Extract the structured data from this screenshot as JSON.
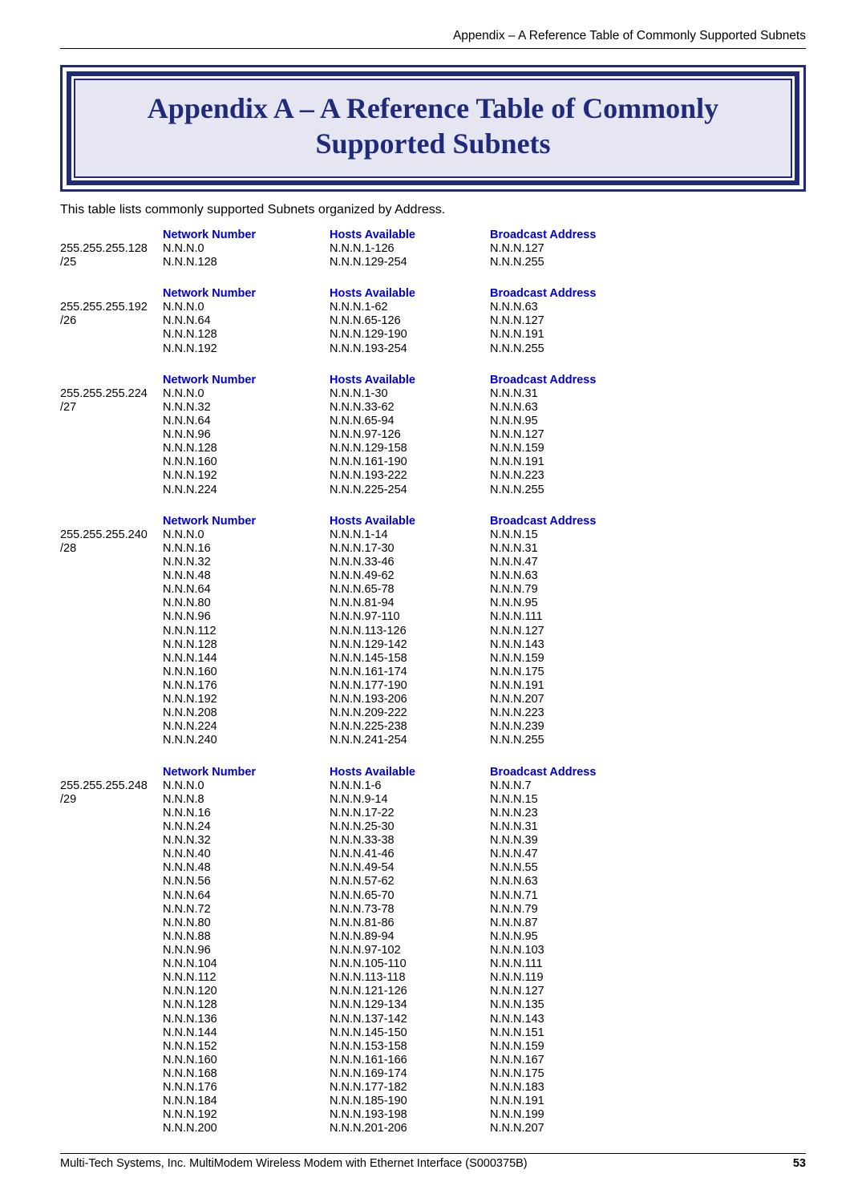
{
  "running_head": "Appendix – A Reference Table of Commonly Supported Subnets",
  "title": "Appendix A – A Reference Table of Commonly Supported Subnets",
  "intro": "This table lists commonly supported Subnets organized by Address.",
  "headers": {
    "net": "Network Number",
    "hosts": "Hosts Available",
    "bcast": "Broadcast Address"
  },
  "footer": {
    "text": "Multi-Tech Systems, Inc. MultiModem Wireless Modem with Ethernet Interface (S000375B)",
    "page": "53"
  },
  "sections": [
    {
      "mask": "255.255.255.128",
      "cidr": "/25",
      "rows": [
        {
          "net": "N.N.N.0",
          "hosts": "N.N.N.1-126",
          "bcast": "N.N.N.127"
        },
        {
          "net": "N.N.N.128",
          "hosts": "N.N.N.129-254",
          "bcast": "N.N.N.255"
        }
      ]
    },
    {
      "mask": "255.255.255.192",
      "cidr": "/26",
      "rows": [
        {
          "net": "N.N.N.0",
          "hosts": "N.N.N.1-62",
          "bcast": "N.N.N.63"
        },
        {
          "net": "N.N.N.64",
          "hosts": "N.N.N.65-126",
          "bcast": "N.N.N.127"
        },
        {
          "net": "N.N.N.128",
          "hosts": "N.N.N.129-190",
          "bcast": "N.N.N.191"
        },
        {
          "net": "N.N.N.192",
          "hosts": "N.N.N.193-254",
          "bcast": "N.N.N.255"
        }
      ]
    },
    {
      "mask": "255.255.255.224",
      "cidr": "/27",
      "rows": [
        {
          "net": "N.N.N.0",
          "hosts": "N.N.N.1-30",
          "bcast": "N.N.N.31"
        },
        {
          "net": "N.N.N.32",
          "hosts": "N.N.N.33-62",
          "bcast": "N.N.N.63"
        },
        {
          "net": "N.N.N.64",
          "hosts": "N.N.N.65-94",
          "bcast": "N.N.N.95"
        },
        {
          "net": "N.N.N.96",
          "hosts": "N.N.N.97-126",
          "bcast": "N.N.N.127"
        },
        {
          "net": "N.N.N.128",
          "hosts": "N.N.N.129-158",
          "bcast": "N.N.N.159"
        },
        {
          "net": "N.N.N.160",
          "hosts": "N.N.N.161-190",
          "bcast": "N.N.N.191"
        },
        {
          "net": "N.N.N.192",
          "hosts": "N.N.N.193-222",
          "bcast": "N.N.N.223"
        },
        {
          "net": "N.N.N.224",
          "hosts": "N.N.N.225-254",
          "bcast": "N.N.N.255"
        }
      ]
    },
    {
      "mask": "255.255.255.240",
      "cidr": "/28",
      "rows": [
        {
          "net": "N.N.N.0",
          "hosts": "N.N.N.1-14",
          "bcast": "N.N.N.15"
        },
        {
          "net": "N.N.N.16",
          "hosts": "N.N.N.17-30",
          "bcast": "N.N.N.31"
        },
        {
          "net": "N.N.N.32",
          "hosts": "N.N.N.33-46",
          "bcast": "N.N.N.47"
        },
        {
          "net": "N.N.N.48",
          "hosts": "N.N.N.49-62",
          "bcast": "N.N.N.63"
        },
        {
          "net": "N.N.N.64",
          "hosts": "N.N.N.65-78",
          "bcast": "N.N.N.79"
        },
        {
          "net": "N.N.N.80",
          "hosts": "N.N.N.81-94",
          "bcast": "N.N.N.95"
        },
        {
          "net": "N.N.N.96",
          "hosts": "N.N.N.97-110",
          "bcast": "N.N.N.111"
        },
        {
          "net": "N.N.N.112",
          "hosts": "N.N.N.113-126",
          "bcast": "N.N.N.127"
        },
        {
          "net": "N.N.N.128",
          "hosts": "N.N.N.129-142",
          "bcast": "N.N.N.143"
        },
        {
          "net": "N.N.N.144",
          "hosts": "N.N.N.145-158",
          "bcast": "N.N.N.159"
        },
        {
          "net": "N.N.N.160",
          "hosts": "N.N.N.161-174",
          "bcast": "N.N.N.175"
        },
        {
          "net": "N.N.N.176",
          "hosts": "N.N.N.177-190",
          "bcast": "N.N.N.191"
        },
        {
          "net": "N.N.N.192",
          "hosts": "N.N.N.193-206",
          "bcast": "N.N.N.207"
        },
        {
          "net": "N.N.N.208",
          "hosts": "N.N.N.209-222",
          "bcast": "N.N.N.223"
        },
        {
          "net": "N.N.N.224",
          "hosts": "N.N.N.225-238",
          "bcast": "N.N.N.239"
        },
        {
          "net": "N.N.N.240",
          "hosts": "N.N.N.241-254",
          "bcast": "N.N.N.255"
        }
      ]
    },
    {
      "mask": "255.255.255.248",
      "cidr": "/29",
      "rows": [
        {
          "net": "N.N.N.0",
          "hosts": "N.N.N.1-6",
          "bcast": "N.N.N.7"
        },
        {
          "net": "N.N.N.8",
          "hosts": "N.N.N.9-14",
          "bcast": "N.N.N.15"
        },
        {
          "net": "N.N.N.16",
          "hosts": "N.N.N.17-22",
          "bcast": "N.N.N.23"
        },
        {
          "net": "N.N.N.24",
          "hosts": "N.N.N.25-30",
          "bcast": "N.N.N.31"
        },
        {
          "net": "N.N.N.32",
          "hosts": "N.N.N.33-38",
          "bcast": "N.N.N.39"
        },
        {
          "net": "N.N.N.40",
          "hosts": "N.N.N.41-46",
          "bcast": "N.N.N.47"
        },
        {
          "net": "N.N.N.48",
          "hosts": "N.N.N.49-54",
          "bcast": "N.N.N.55"
        },
        {
          "net": "N.N.N.56",
          "hosts": "N.N.N.57-62",
          "bcast": "N.N.N.63"
        },
        {
          "net": "N.N.N.64",
          "hosts": "N.N.N.65-70",
          "bcast": "N.N.N.71"
        },
        {
          "net": "N.N.N.72",
          "hosts": "N.N.N.73-78",
          "bcast": "N.N.N.79"
        },
        {
          "net": "N.N.N.80",
          "hosts": "N.N.N.81-86",
          "bcast": "N.N.N.87"
        },
        {
          "net": "N.N.N.88",
          "hosts": "N.N.N.89-94",
          "bcast": "N.N.N.95"
        },
        {
          "net": "N.N.N.96",
          "hosts": "N.N.N.97-102",
          "bcast": "N.N.N.103"
        },
        {
          "net": "N.N.N.104",
          "hosts": "N.N.N.105-110",
          "bcast": "N.N.N.111"
        },
        {
          "net": "N.N.N.112",
          "hosts": "N.N.N.113-118",
          "bcast": "N.N.N.119"
        },
        {
          "net": "N.N.N.120",
          "hosts": "N.N.N.121-126",
          "bcast": "N.N.N.127"
        },
        {
          "net": "N.N.N.128",
          "hosts": "N.N.N.129-134",
          "bcast": "N.N.N.135"
        },
        {
          "net": "N.N.N.136",
          "hosts": "N.N.N.137-142",
          "bcast": "N.N.N.143"
        },
        {
          "net": "N.N.N.144",
          "hosts": "N.N.N.145-150",
          "bcast": "N.N.N.151"
        },
        {
          "net": "N.N.N.152",
          "hosts": "N.N.N.153-158",
          "bcast": "N.N.N.159"
        },
        {
          "net": "N.N.N.160",
          "hosts": "N.N.N.161-166",
          "bcast": "N.N.N.167"
        },
        {
          "net": "N.N.N.168",
          "hosts": "N.N.N.169-174",
          "bcast": "N.N.N.175"
        },
        {
          "net": "N.N.N.176",
          "hosts": "N.N.N.177-182",
          "bcast": "N.N.N.183"
        },
        {
          "net": "N.N.N.184",
          "hosts": "N.N.N.185-190",
          "bcast": "N.N.N.191"
        },
        {
          "net": "N.N.N.192",
          "hosts": "N.N.N.193-198",
          "bcast": "N.N.N.199"
        },
        {
          "net": "N.N.N.200",
          "hosts": "N.N.N.201-206",
          "bcast": "N.N.N.207"
        }
      ]
    }
  ]
}
